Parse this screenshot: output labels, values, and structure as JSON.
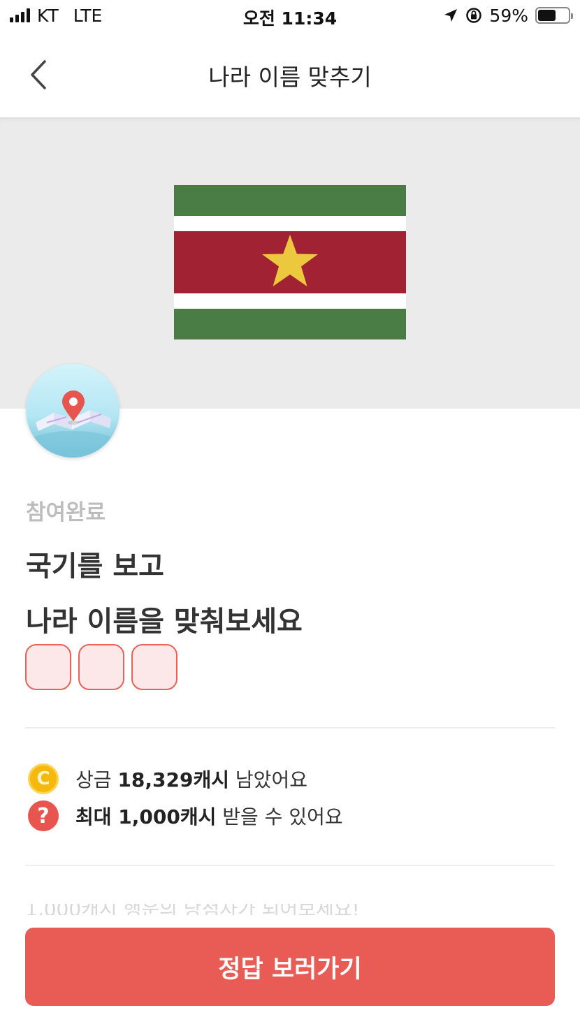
{
  "status_bar": {
    "carrier": "KT",
    "network": "LTE",
    "time": "오전 11:34",
    "battery": "59%",
    "battery_level": 0.59
  },
  "nav": {
    "title": "나라 이름 맞추기",
    "back_icon": "chevron-left-icon"
  },
  "quiz": {
    "flag_icon": "suriname-flag",
    "flag_colors": {
      "green": "#4a7c45",
      "white": "#ffffff",
      "red": "#a12232",
      "star": "#ecc83f"
    },
    "status": "참여완료",
    "title_line1": "국기를 보고",
    "title_line2": "나라 이름을 맞춰보세요",
    "answer_box_count": 3
  },
  "info": {
    "prize_icon": "coin-icon",
    "prize_prefix": "상금",
    "prize_amount": "18,329캐시",
    "prize_suffix": "남았어요",
    "max_icon": "question-icon",
    "max_amount": "최대 1,000캐시",
    "max_suffix": "받을 수 있어요"
  },
  "faded_text": "1,000캐시 행운의 당첨자가 되어보세요!",
  "cta_label": "정답 보러가기",
  "colors": {
    "accent": "#e95c55",
    "hero_bg": "#ebebeb",
    "coin": "#f5b80d"
  }
}
